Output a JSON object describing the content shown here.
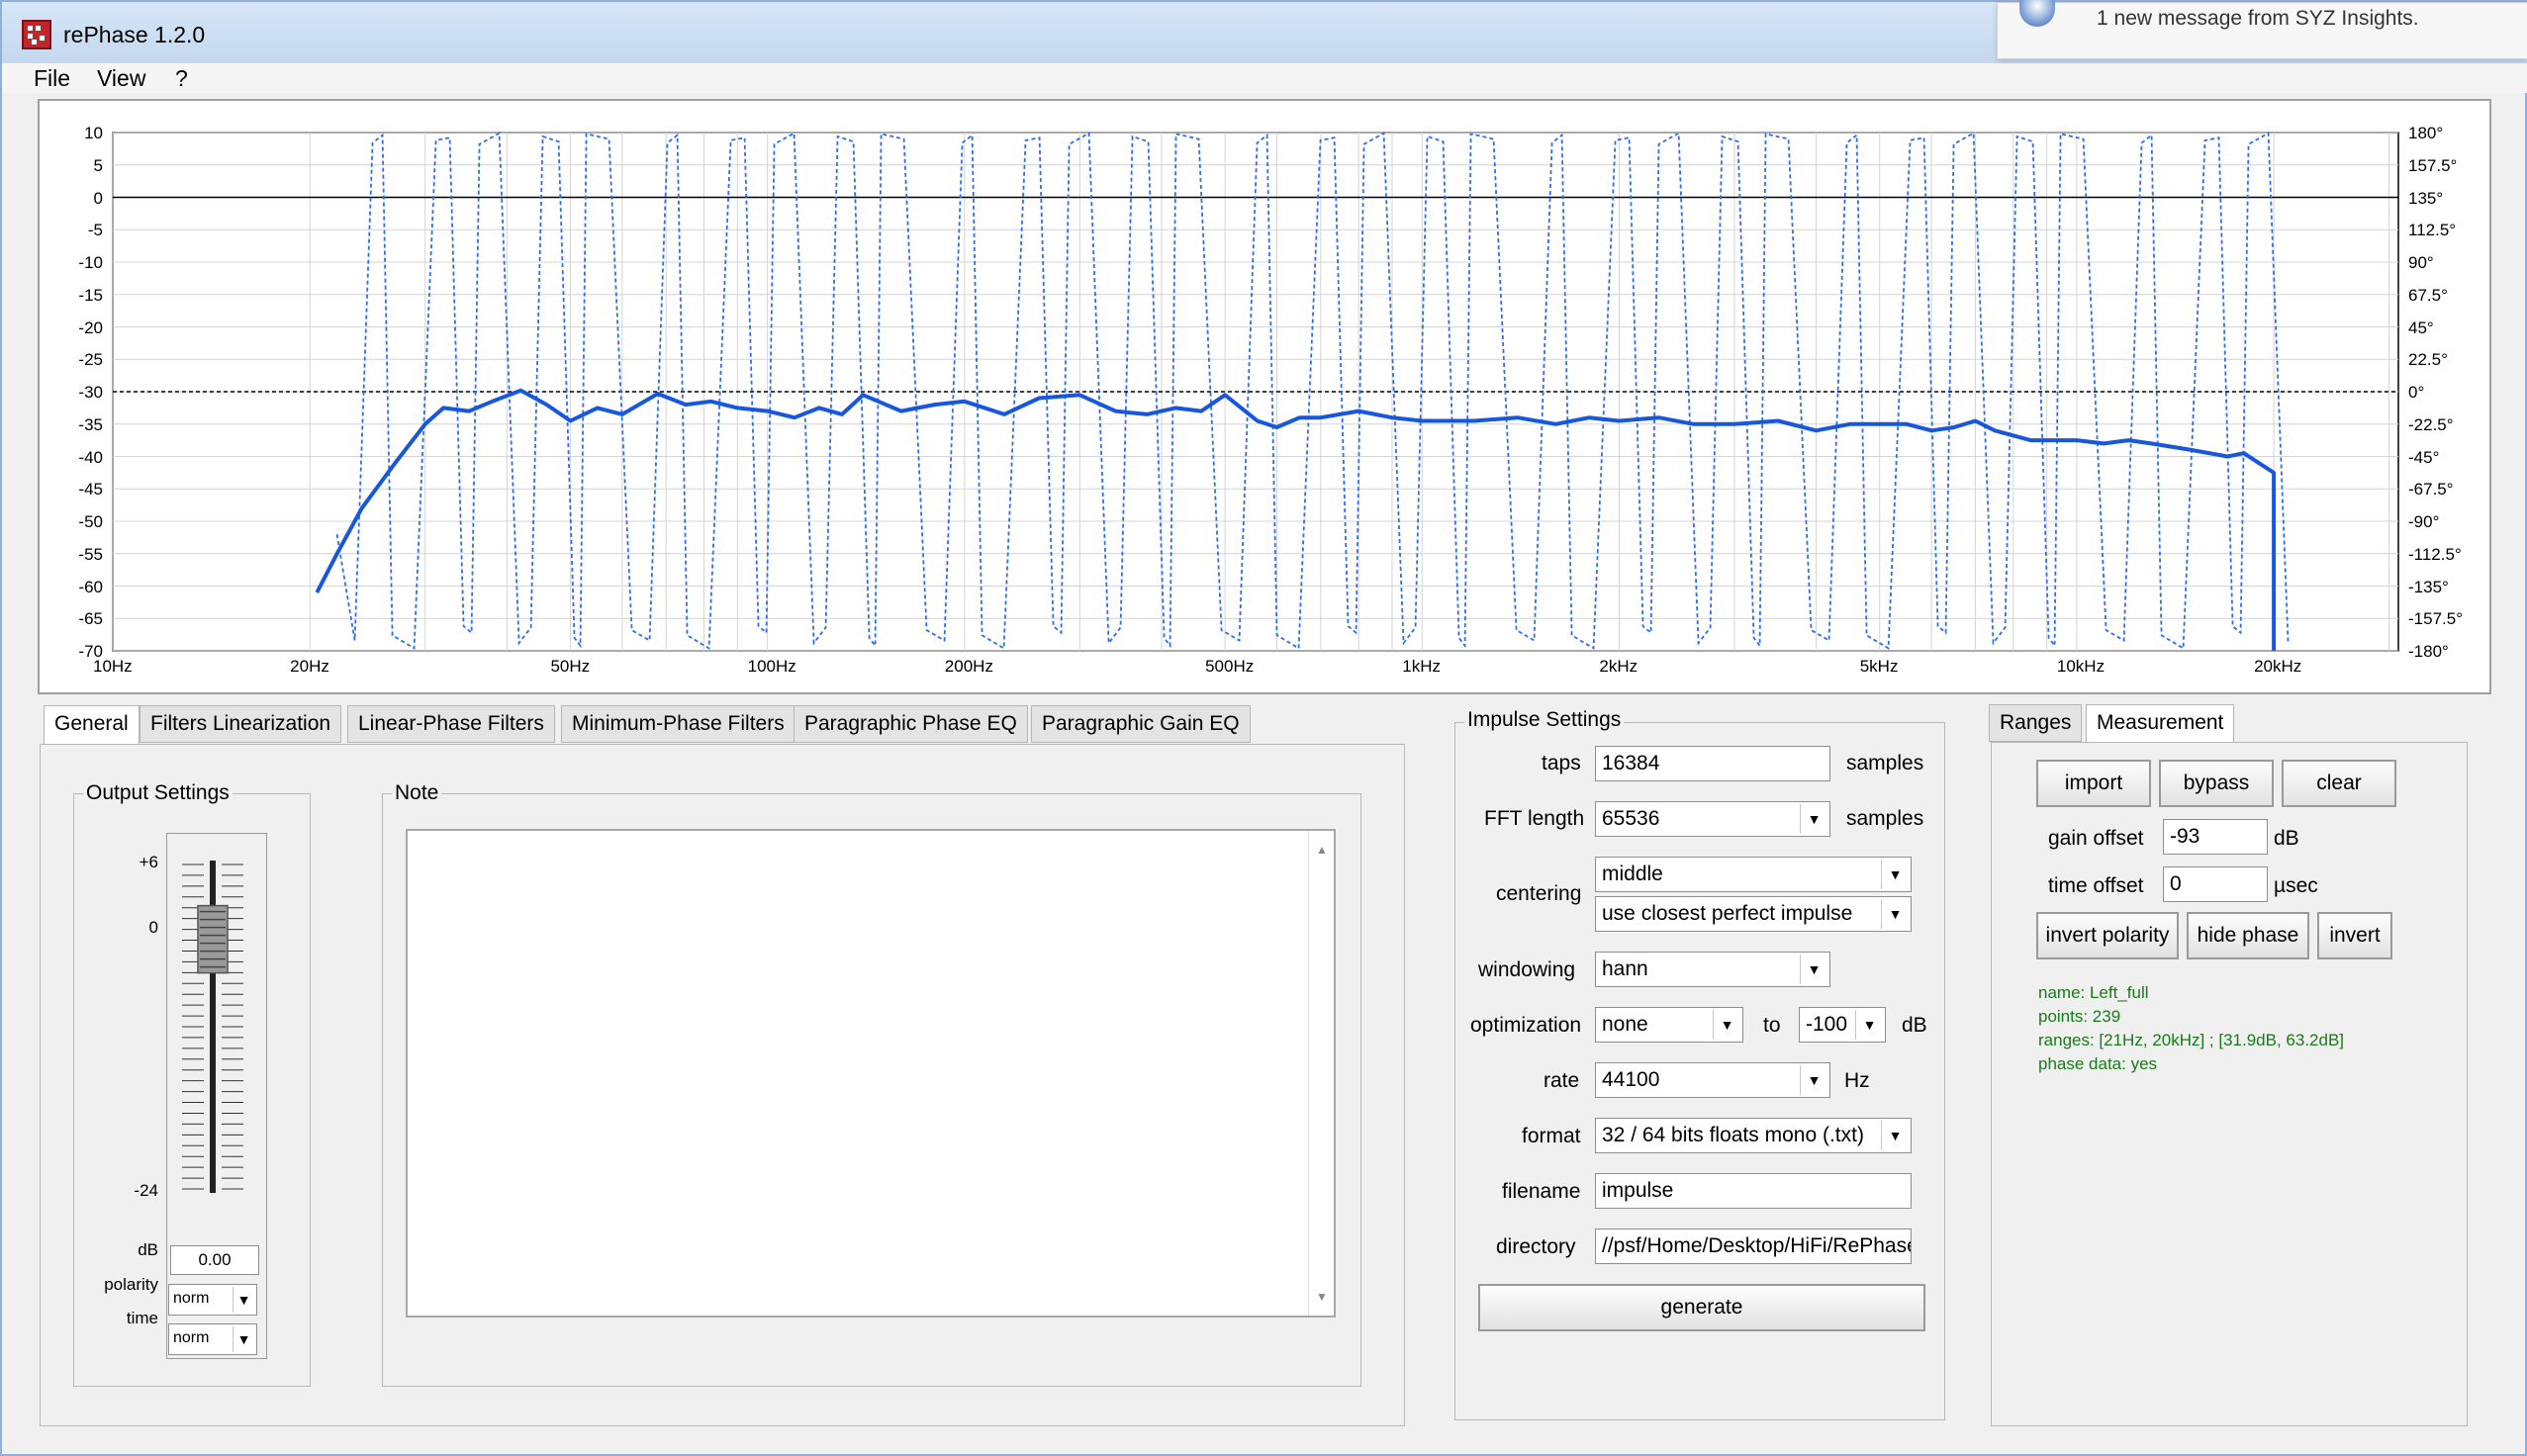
{
  "window": {
    "title": "rePhase 1.2.0"
  },
  "notification": {
    "text": "1 new message from SYZ Insights."
  },
  "menu": {
    "items": [
      "File",
      "View",
      "?"
    ]
  },
  "plot": {
    "y_left_ticks": [
      "10",
      "5",
      "0",
      "-5",
      "-10",
      "-15",
      "-20",
      "-25",
      "-30",
      "-35",
      "-40",
      "-45",
      "-50",
      "-55",
      "-60",
      "-65",
      "-70"
    ],
    "y_right_ticks": [
      "180°",
      "157.5°",
      "135°",
      "112.5°",
      "90°",
      "67.5°",
      "45°",
      "22.5°",
      "0°",
      "-22.5°",
      "-45°",
      "-67.5°",
      "-90°",
      "-112.5°",
      "-135°",
      "-157.5°",
      "-180°"
    ],
    "x_ticks": [
      "10Hz",
      "20Hz",
      "50Hz",
      "100Hz",
      "200Hz",
      "500Hz",
      "1kHz",
      "2kHz",
      "5kHz",
      "10kHz",
      "20kHz"
    ],
    "x_tick_freqs": [
      10,
      20,
      50,
      100,
      200,
      500,
      1000,
      2000,
      5000,
      10000,
      20000
    ],
    "reference_level_db": -30,
    "magnitude_color": "#1757e0",
    "phase_color": "#2f6df0",
    "magnitude_curve": [
      [
        20.5,
        -61
      ],
      [
        22,
        -55
      ],
      [
        24,
        -48
      ],
      [
        27,
        -41
      ],
      [
        30,
        -35
      ],
      [
        32,
        -32.5
      ],
      [
        35,
        -33
      ],
      [
        38,
        -31.5
      ],
      [
        42,
        -29.8
      ],
      [
        46,
        -32
      ],
      [
        50,
        -34.5
      ],
      [
        55,
        -32.5
      ],
      [
        60,
        -33.5
      ],
      [
        68,
        -30.3
      ],
      [
        75,
        -32
      ],
      [
        82,
        -31.5
      ],
      [
        90,
        -32.5
      ],
      [
        100,
        -33
      ],
      [
        110,
        -34
      ],
      [
        120,
        -32.5
      ],
      [
        130,
        -33.5
      ],
      [
        140,
        -30.5
      ],
      [
        160,
        -33
      ],
      [
        180,
        -32
      ],
      [
        200,
        -31.5
      ],
      [
        230,
        -33.5
      ],
      [
        260,
        -31
      ],
      [
        300,
        -30.5
      ],
      [
        340,
        -33
      ],
      [
        380,
        -33.5
      ],
      [
        420,
        -32.5
      ],
      [
        460,
        -33
      ],
      [
        500,
        -30.5
      ],
      [
        560,
        -34.5
      ],
      [
        600,
        -35.5
      ],
      [
        650,
        -34
      ],
      [
        700,
        -34
      ],
      [
        800,
        -33
      ],
      [
        900,
        -34
      ],
      [
        1000,
        -34.5
      ],
      [
        1200,
        -34.5
      ],
      [
        1400,
        -34
      ],
      [
        1600,
        -35
      ],
      [
        1800,
        -34
      ],
      [
        2000,
        -34.5
      ],
      [
        2300,
        -34
      ],
      [
        2600,
        -35
      ],
      [
        3000,
        -35
      ],
      [
        3500,
        -34.5
      ],
      [
        4000,
        -36
      ],
      [
        4500,
        -35
      ],
      [
        5000,
        -35
      ],
      [
        5500,
        -35
      ],
      [
        6000,
        -36
      ],
      [
        6500,
        -35.5
      ],
      [
        7000,
        -34.5
      ],
      [
        7500,
        -36
      ],
      [
        8500,
        -37.5
      ],
      [
        10000,
        -37.5
      ],
      [
        11000,
        -38
      ],
      [
        12000,
        -37.5
      ],
      [
        13000,
        -38
      ],
      [
        15000,
        -39
      ],
      [
        17000,
        -40
      ],
      [
        18000,
        -39.5
      ],
      [
        20000,
        -42.5
      ],
      [
        20000,
        -70
      ]
    ]
  },
  "tabs": {
    "items": [
      "General",
      "Filters Linearization",
      "Linear-Phase Filters",
      "Minimum-Phase Filters",
      "Paragraphic Phase EQ",
      "Paragraphic Gain EQ"
    ],
    "active": 0
  },
  "output": {
    "title": "Output Settings",
    "top_label": "+6",
    "zero_label": "0",
    "bottom_label": "-24",
    "db_label": "dB",
    "db_value": "0.00",
    "polarity_label": "polarity",
    "polarity_value": "norm",
    "time_label": "time",
    "time_value": "norm",
    "fader_level_db": 0
  },
  "note": {
    "title": "Note",
    "text": ""
  },
  "impulse": {
    "title": "Impulse Settings",
    "taps_label": "taps",
    "taps_value": "16384",
    "taps_unit": "samples",
    "fft_label": "FFT length",
    "fft_value": "65536",
    "fft_unit": "samples",
    "centering_label": "centering",
    "centering_value": "middle",
    "centering_mode": "use closest perfect impulse",
    "windowing_label": "windowing",
    "windowing_value": "hann",
    "optimization_label": "optimization",
    "optimization_value": "none",
    "optimization_to": "to",
    "optimization_db": "-100",
    "optimization_unit": "dB",
    "rate_label": "rate",
    "rate_value": "44100",
    "rate_unit": "Hz",
    "format_label": "format",
    "format_value": "32 / 64 bits floats mono (.txt)",
    "filename_label": "filename",
    "filename_value": "impulse",
    "directory_label": "directory",
    "directory_value": "//psf/Home/Desktop/HiFi/RePhase",
    "generate_label": "generate"
  },
  "measurement": {
    "tabs": [
      "Ranges",
      "Measurement"
    ],
    "import_label": "import",
    "bypass_label": "bypass",
    "clear_label": "clear",
    "gain_label": "gain offset",
    "gain_value": "-93",
    "gain_unit": "dB",
    "time_label": "time offset",
    "time_value": "0",
    "time_unit": "µsec",
    "invert_polarity_label": "invert polarity",
    "hide_phase_label": "hide phase",
    "invert_label": "invert",
    "info_name": "name: Left_full",
    "info_points": "points: 239",
    "info_ranges": "ranges: [21Hz, 20kHz] ; [31.9dB, 63.2dB]",
    "info_phase": "phase data: yes"
  }
}
